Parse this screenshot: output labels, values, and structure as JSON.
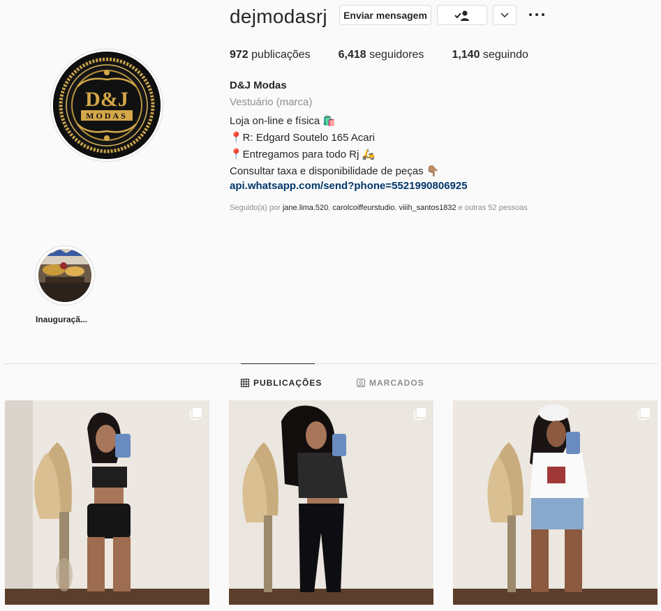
{
  "header": {
    "username": "dejmodasrj",
    "message_button": "Enviar mensagem"
  },
  "stats": {
    "posts_count": "972",
    "posts_label": "publicações",
    "followers_count": "6,418",
    "followers_label": "seguidores",
    "following_count": "1,140",
    "following_label": "seguindo"
  },
  "bio": {
    "name": "D&J Modas",
    "category": "Vestuário (marca)",
    "line1": "Loja on-line e física 🛍️",
    "line2": "📍R: Edgard Soutelo 165 Acari",
    "line3": "📍Entregamos para todo Rj 🛵",
    "line4": "Consultar taxa e disponibilidade de peças 👇🏽",
    "link": "api.whatsapp.com/send?phone=5521990806925"
  },
  "followed_by": {
    "prefix": "Seguido(a) por",
    "user1": "jane.lima.520",
    "user2": "carolcoiffeurstudio",
    "user3": "viiih_santos1832",
    "suffix": "e outras 52 pessoas"
  },
  "avatar": {
    "logo_text": "D&J",
    "logo_subtext": "MODAS"
  },
  "highlight": {
    "label": "Inauguraçã..."
  },
  "tabs": {
    "posts": "PUBLICAÇÕES",
    "tagged": "MARCADOS"
  },
  "icons": {
    "follow_status": "person-check-icon",
    "chevron": "chevron-down-icon",
    "more": "more-options-icon",
    "grid": "grid-icon",
    "tagged": "tagged-user-icon",
    "multi_photo": "carousel-icon"
  },
  "colors": {
    "link": "#00376b",
    "muted": "#8e8e8e",
    "text": "#262626",
    "logo_gold": "#d4a84a"
  }
}
